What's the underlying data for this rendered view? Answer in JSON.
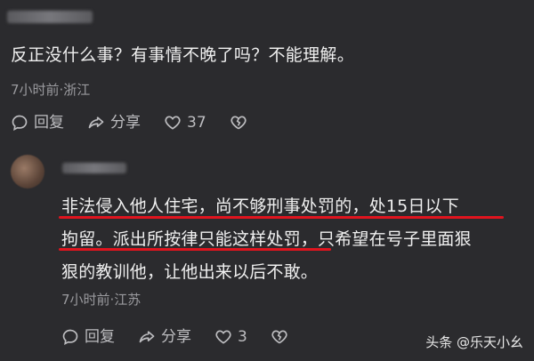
{
  "comment1": {
    "text": "反正没什么事？有事情不晚了吗？不能理解。",
    "meta": "7小时前·浙江",
    "actions": {
      "reply_label": "回复",
      "share_label": "分享",
      "like_count": "37"
    }
  },
  "comment2": {
    "lines": [
      "非法侵入他人住宅，尚不够刑事处罚的，处15日以下",
      "拘留。派出所按律只能这样处罚，只希望在号子里面狠",
      "狠的教训他，让他出来以后不敢。"
    ],
    "meta": "7小时前·江苏",
    "actions": {
      "reply_label": "回复",
      "share_label": "分享",
      "like_count": "3"
    }
  },
  "watermark": "头条 @乐天小幺",
  "colors": {
    "background": "#2b2b2e",
    "underline": "#e0141e"
  }
}
